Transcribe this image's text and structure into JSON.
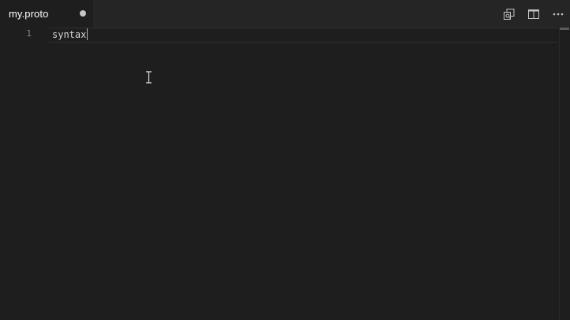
{
  "tab": {
    "filename": "my.proto",
    "dirty": true
  },
  "actions": [
    {
      "name": "open-preview-icon"
    },
    {
      "name": "split-editor-icon"
    },
    {
      "name": "more-actions-icon"
    }
  ],
  "editor": {
    "lines": [
      {
        "number": "1",
        "text": "syntax"
      }
    ]
  },
  "colors": {
    "background": "#1e1e1e",
    "tabbar": "#252526",
    "text": "#d4d4d4",
    "line_number": "#858585"
  }
}
